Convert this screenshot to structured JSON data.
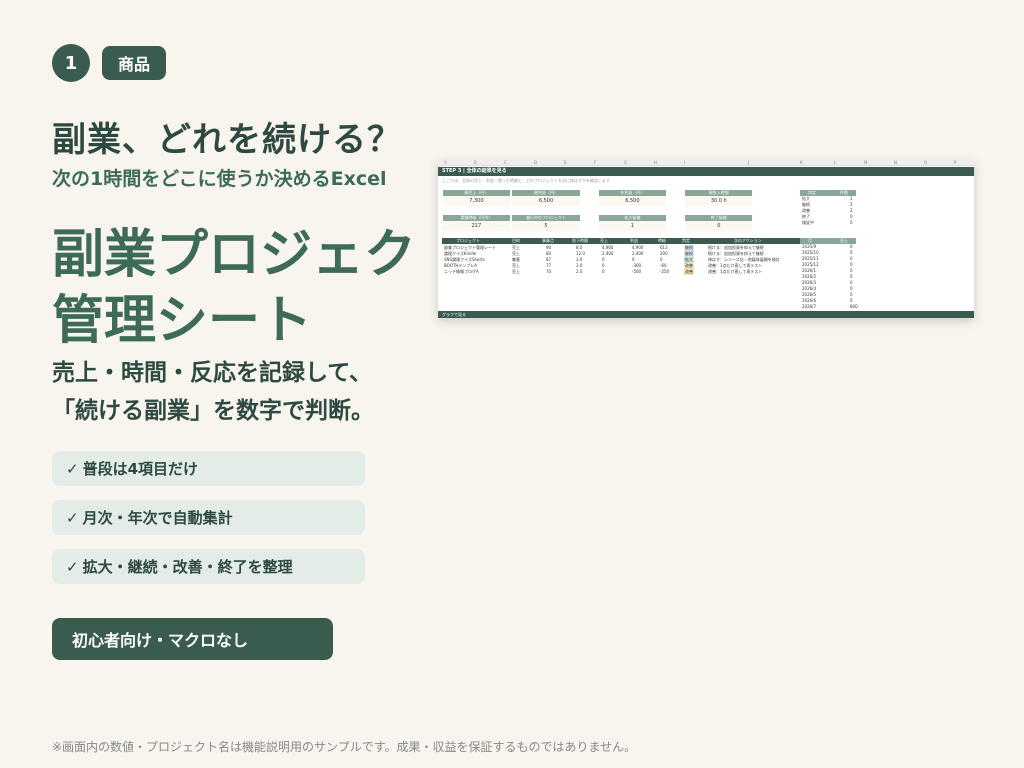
{
  "badge": {
    "number": "1",
    "tag": "商品"
  },
  "question_title": "副業、どれを続ける？",
  "subtitle": "次の1時間をどこに使うか決めるExcel",
  "main_title": [
    "副業プロジェク",
    "管理シート"
  ],
  "description": [
    "売上・時間・反応を記録して、",
    "「続ける副業」を数字で判断。"
  ],
  "checks": [
    "普段は4項目だけ",
    "月次・年次で自動集計",
    "拡大・継続・改善・終了を整理"
  ],
  "check_mark": "✓",
  "cta": "初心者向け・マクロなし",
  "footnote": "※画面内の数値・プロジェクト名は機能説明用のサンプルです。成果・収益を保証するものではありません。",
  "sheet": {
    "columns": [
      "A",
      "B",
      "C",
      "D",
      "E",
      "F",
      "G",
      "H",
      "I",
      "J",
      "K",
      "L",
      "M",
      "N",
      "O",
      "P"
    ],
    "step_title": "STEP 3 | 全体の結果を見る",
    "step_note": "ここでは、全体の売上・利益・使った時間と、どのプロジェクトを次に伸ばすかを確認します",
    "kpis_row1": [
      {
        "label": "総売上（円）",
        "value": "7,300"
      },
      {
        "label": "総利益（円）",
        "value": "6,500"
      },
      {
        "label": "年利益（円）",
        "value": "6,500"
      },
      {
        "label": "総投入時間",
        "value": "30.0 h"
      }
    ],
    "kpis_row2": [
      {
        "label": "実質時給（円/h）",
        "value": "217"
      },
      {
        "label": "進行中のプロジェクト",
        "value": "5"
      },
      {
        "label": "拡大候補",
        "value": "1"
      },
      {
        "label": "終了候補",
        "value": "0"
      }
    ],
    "table_headers": [
      "プロジェクト",
      "目的",
      "事業点",
      "投下時間",
      "売上",
      "利益",
      "時給",
      "判定",
      "次のアクション"
    ],
    "table_rows": [
      [
        "副業プロジェクト管理シート",
        "売上",
        "90",
        "8.0",
        "4,900",
        "4,900",
        "613",
        "継続",
        "続ける：追加投資を抑えて継続"
      ],
      [
        "論理クイズKindle",
        "売上",
        "80",
        "12.0",
        "2,400",
        "2,400",
        "200",
        "継続",
        "続ける：追加投資を抑えて継続"
      ],
      [
        "SNS論理クイズShorts",
        "集客",
        "87",
        "3.0",
        "0",
        "0",
        "0",
        "拡大",
        "伸ばす：シリーズ化・他媒体展開を検討"
      ],
      [
        "BOOTHテンプレA",
        "売上",
        "77",
        "3.0",
        "0",
        "-300",
        "-60",
        "改善",
        "改善：1点だけ直して再テスト"
      ],
      [
        "ニッチ情報ブログA",
        "売上",
        "70",
        "2.0",
        "0",
        "-500",
        "-250",
        "改善",
        "改善：1点だけ直して再テスト"
      ]
    ],
    "summary_headers": [
      "判定",
      "件数"
    ],
    "summary_rows": [
      [
        "拡大",
        "1"
      ],
      [
        "継続",
        "2"
      ],
      [
        "改善",
        "2"
      ],
      [
        "終了",
        "0"
      ],
      [
        "検証中",
        "0"
      ]
    ],
    "monthly_headers": [
      "月",
      "売上"
    ],
    "monthly_rows": [
      [
        "2025/9",
        "0"
      ],
      [
        "2025/10",
        "0"
      ],
      [
        "2025/11",
        "0"
      ],
      [
        "2025/12",
        "0"
      ],
      [
        "2026/1",
        "0"
      ],
      [
        "2026/2",
        "0"
      ],
      [
        "2026/3",
        "0"
      ],
      [
        "2026/4",
        "0"
      ],
      [
        "2026/5",
        "0"
      ],
      [
        "2026/6",
        "0"
      ],
      [
        "2026/7",
        "800"
      ]
    ],
    "bottom_bar": "グラフで見る",
    "colors": {
      "dark_green": "#3a5c4e",
      "kpi_header": "#8aa69a",
      "grow": "#cfe3d6",
      "keep": "#dbe7f0",
      "improve": "#f6e3bd"
    }
  }
}
